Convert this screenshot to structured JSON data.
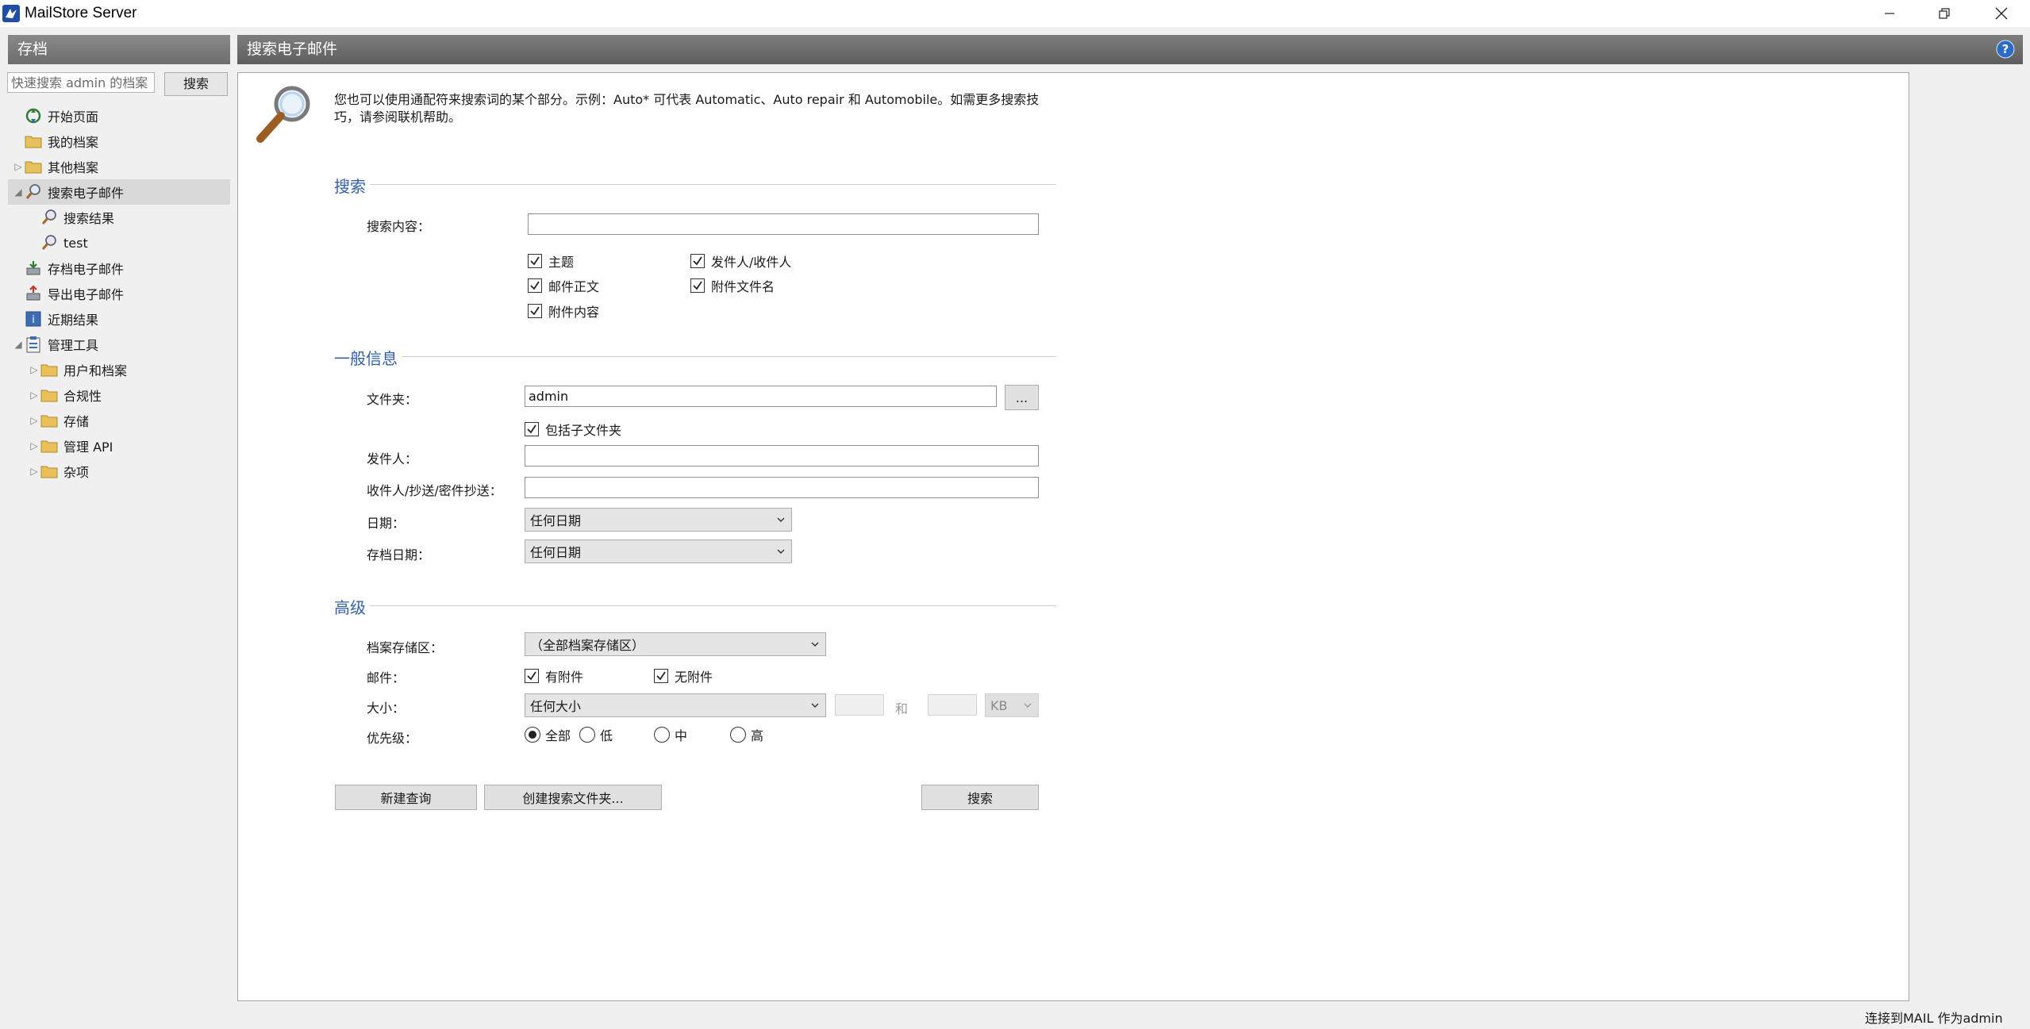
{
  "window": {
    "title": "MailStore Server"
  },
  "sidebar": {
    "header": "存档",
    "quick_search_placeholder": "快速搜索 admin 的档案",
    "quick_search_button": "搜索",
    "items": [
      {
        "label": "开始页面",
        "icon": "start-page-icon"
      },
      {
        "label": "我的档案",
        "icon": "folder-icon"
      },
      {
        "label": "其他档案",
        "icon": "folder-icon"
      },
      {
        "label": "搜索电子邮件",
        "icon": "search-icon"
      },
      {
        "label": "搜索结果",
        "icon": "search-icon"
      },
      {
        "label": "test",
        "icon": "search-icon"
      },
      {
        "label": "存档电子邮件",
        "icon": "archive-icon"
      },
      {
        "label": "导出电子邮件",
        "icon": "export-icon"
      },
      {
        "label": "近期结果",
        "icon": "recent-results-icon"
      },
      {
        "label": "管理工具",
        "icon": "admin-tools-icon"
      },
      {
        "label": "用户和档案",
        "icon": "folder-icon"
      },
      {
        "label": "合规性",
        "icon": "folder-icon"
      },
      {
        "label": "存储",
        "icon": "folder-icon"
      },
      {
        "label": "管理 API",
        "icon": "folder-icon"
      },
      {
        "label": "杂项",
        "icon": "folder-icon"
      }
    ]
  },
  "main": {
    "header": "搜索电子邮件",
    "info_text": "您也可以使用通配符来搜索词的某个部分。示例：Auto* 可代表 Automatic、Auto repair 和 Automobile。如需更多搜索技巧，请参阅联机帮助。",
    "search_section": {
      "title": "搜索",
      "content_label": "搜索内容：",
      "content_value": "",
      "options": {
        "subject": "主题",
        "from_to": "发件人/收件人",
        "body": "邮件正文",
        "attachment_name": "附件文件名",
        "attachment_content": "附件内容"
      }
    },
    "general_section": {
      "title": "一般信息",
      "folder_label": "文件夹：",
      "folder_value": "admin",
      "browse_button": "...",
      "include_subfolders": "包括子文件夹",
      "from_label": "发件人：",
      "from_value": "",
      "to_label": "收件人/抄送/密件抄送：",
      "to_value": "",
      "date_label": "日期：",
      "date_value": "任何日期",
      "archive_date_label": "存档日期：",
      "archive_date_value": "任何日期"
    },
    "advanced_section": {
      "title": "高级",
      "store_label": "档案存储区：",
      "store_value": "（全部档案存储区）",
      "mail_label": "邮件：",
      "with_attachment": "有附件",
      "without_attachment": "无附件",
      "size_label": "大小：",
      "size_value": "任何大小",
      "size_and": "和",
      "size_unit": "KB",
      "priority_label": "优先级：",
      "priority_all": "全部",
      "priority_low": "低",
      "priority_mid": "中",
      "priority_high": "高"
    },
    "buttons": {
      "new_query": "新建查询",
      "create_search_folder": "创建搜索文件夹...",
      "search": "搜索"
    }
  },
  "status_bar": {
    "text": "连接到MAIL 作为admin"
  },
  "colors": {
    "section_title": "#3560a8",
    "header_bg": "#6d6d6d",
    "selected_row": "#d9d9d9"
  }
}
